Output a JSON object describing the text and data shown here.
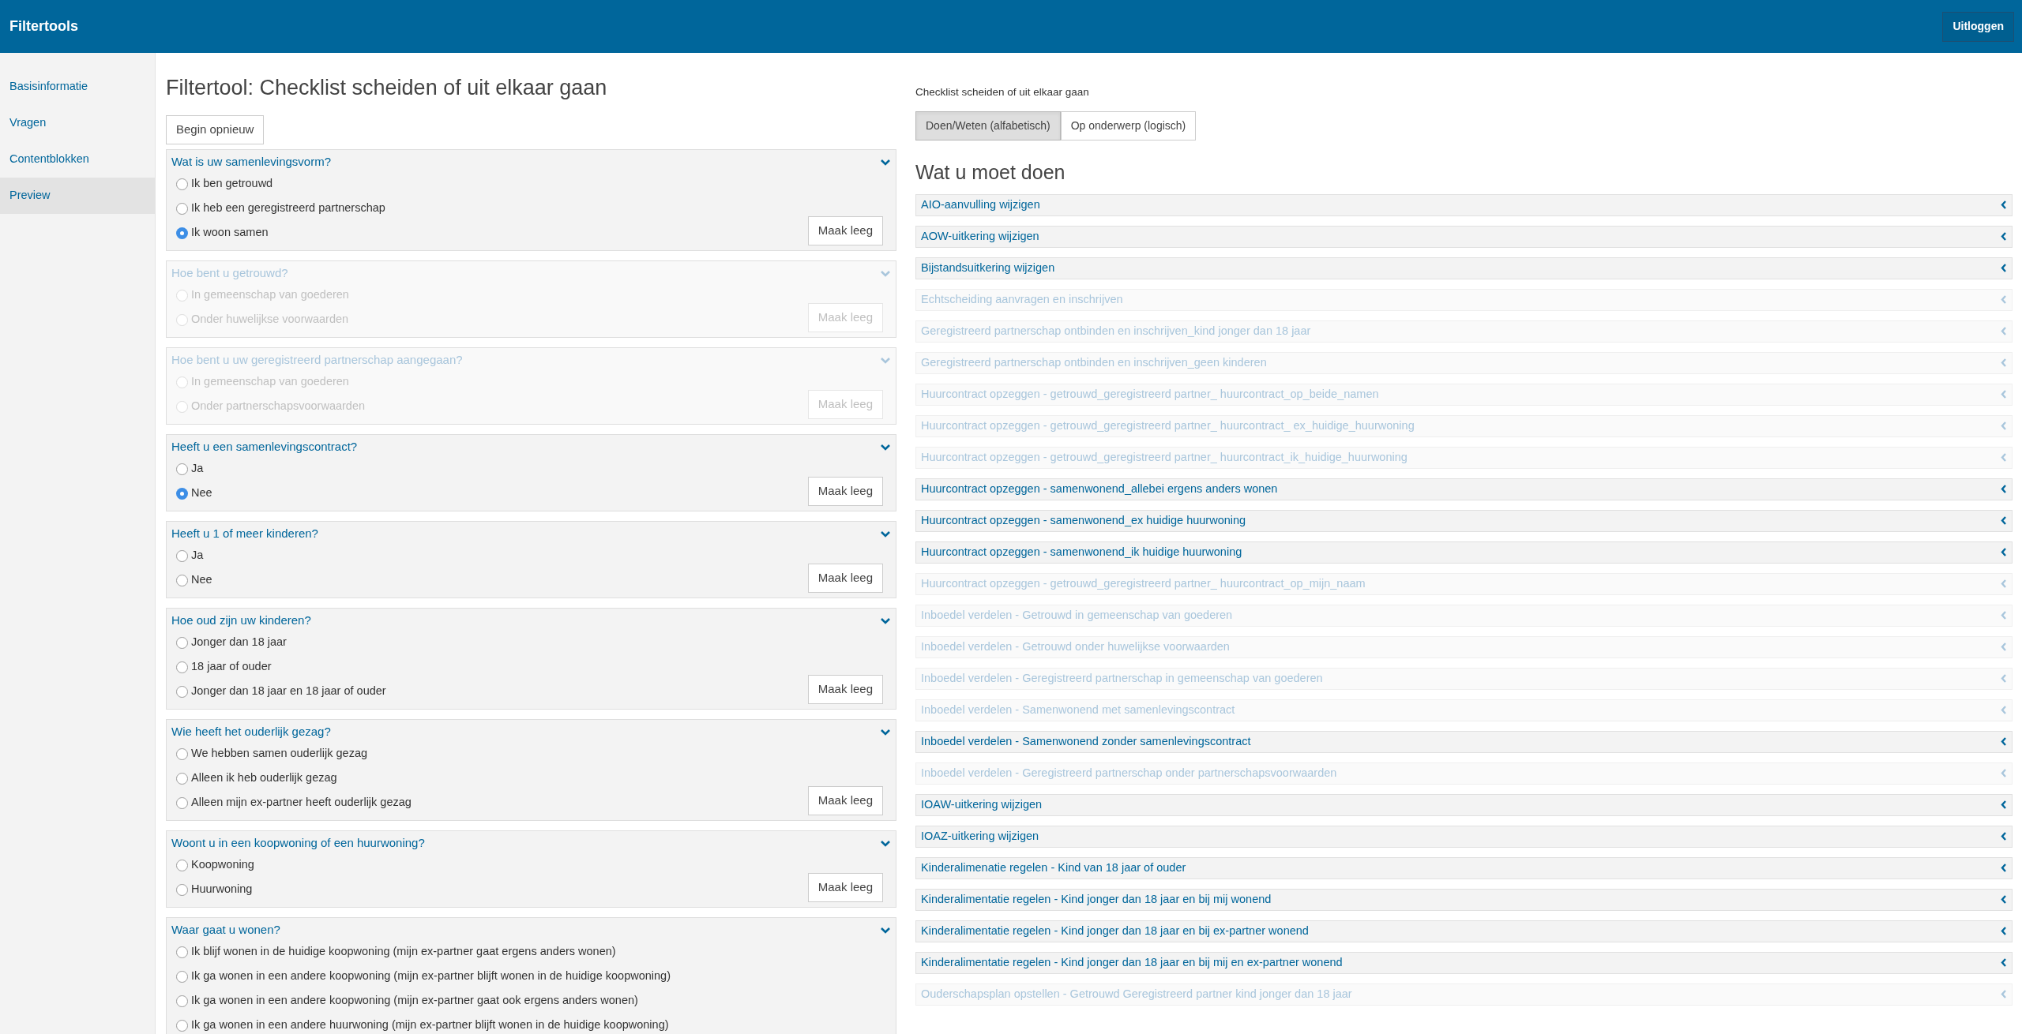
{
  "header": {
    "title": "Filtertools",
    "logout_button": "Uitloggen"
  },
  "sidebar": {
    "items": [
      {
        "label": "Basisinformatie",
        "selected": false
      },
      {
        "label": "Vragen",
        "selected": false
      },
      {
        "label": "Contentblokken",
        "selected": false
      },
      {
        "label": "Preview",
        "selected": true
      }
    ]
  },
  "page_title": "Filtertool: Checklist scheiden of uit elkaar gaan",
  "restart_button": "Begin opnieuw",
  "questions": [
    {
      "title": "Wat is uw samenlevingsvorm?",
      "disabled": false,
      "clear_button": "Maak leeg",
      "options": [
        {
          "label": "Ik ben getrouwd",
          "selected": false
        },
        {
          "label": "Ik heb een geregistreerd partnerschap",
          "selected": false
        },
        {
          "label": "Ik woon samen",
          "selected": true
        }
      ]
    },
    {
      "title": "Hoe bent u getrouwd?",
      "disabled": true,
      "clear_button": "Maak leeg",
      "options": [
        {
          "label": "In gemeenschap van goederen",
          "selected": false
        },
        {
          "label": "Onder huwelijkse voorwaarden",
          "selected": false
        }
      ]
    },
    {
      "title": "Hoe bent u uw geregistreerd partnerschap aangegaan?",
      "disabled": true,
      "clear_button": "Maak leeg",
      "options": [
        {
          "label": "In gemeenschap van goederen",
          "selected": false
        },
        {
          "label": "Onder partnerschapsvoorwaarden",
          "selected": false
        }
      ]
    },
    {
      "title": "Heeft u een samenlevingscontract?",
      "disabled": false,
      "clear_button": "Maak leeg",
      "options": [
        {
          "label": "Ja",
          "selected": false
        },
        {
          "label": "Nee",
          "selected": true
        }
      ]
    },
    {
      "title": "Heeft u 1 of meer kinderen?",
      "disabled": false,
      "clear_button": "Maak leeg",
      "options": [
        {
          "label": "Ja",
          "selected": false
        },
        {
          "label": "Nee",
          "selected": false
        }
      ]
    },
    {
      "title": "Hoe oud zijn uw kinderen?",
      "disabled": false,
      "clear_button": "Maak leeg",
      "options": [
        {
          "label": "Jonger dan 18 jaar",
          "selected": false
        },
        {
          "label": "18 jaar of ouder",
          "selected": false
        },
        {
          "label": "Jonger dan 18 jaar en 18 jaar of ouder",
          "selected": false
        }
      ]
    },
    {
      "title": "Wie heeft het ouderlijk gezag?",
      "disabled": false,
      "clear_button": "Maak leeg",
      "options": [
        {
          "label": "We hebben samen ouderlijk gezag",
          "selected": false
        },
        {
          "label": "Alleen ik heb ouderlijk gezag",
          "selected": false
        },
        {
          "label": "Alleen mijn ex-partner heeft ouderlijk gezag",
          "selected": false
        }
      ]
    },
    {
      "title": "Woont u in een koopwoning of een huurwoning?",
      "disabled": false,
      "clear_button": "Maak leeg",
      "options": [
        {
          "label": "Koopwoning",
          "selected": false
        },
        {
          "label": "Huurwoning",
          "selected": false
        }
      ]
    },
    {
      "title": "Waar gaat u wonen?",
      "disabled": false,
      "options": [
        {
          "label": "Ik blijf wonen in de huidige koopwoning (mijn ex-partner gaat ergens anders wonen)",
          "selected": false
        },
        {
          "label": "Ik ga wonen in een andere koopwoning (mijn ex-partner blijft wonen in de huidige koopwoning)",
          "selected": false
        },
        {
          "label": "Ik ga wonen in een andere koopwoning (mijn ex-partner gaat ook ergens anders wonen)",
          "selected": false
        },
        {
          "label": "Ik ga wonen in een andere huurwoning (mijn ex-partner blijft wonen in de huidige koopwoning)",
          "selected": false
        }
      ]
    }
  ],
  "checklist": {
    "title": "Checklist scheiden of uit elkaar gaan",
    "view_tabs": [
      {
        "label": "Doen/Weten (alfabetisch)",
        "selected": true
      },
      {
        "label": "Op onderwerp (logisch)",
        "selected": false
      }
    ],
    "section_title": "Wat u moet doen",
    "items": [
      {
        "label": "AIO-aanvulling wijzigen",
        "disabled": false
      },
      {
        "label": "AOW-uitkering wijzigen",
        "disabled": false
      },
      {
        "label": "Bijstandsuitkering wijzigen",
        "disabled": false
      },
      {
        "label": "Echtscheiding aanvragen en inschrijven",
        "disabled": true
      },
      {
        "label": "Geregistreerd partnerschap ontbinden en inschrijven_kind jonger dan 18 jaar",
        "disabled": true
      },
      {
        "label": "Geregistreerd partnerschap ontbinden en inschrijven_geen kinderen",
        "disabled": true
      },
      {
        "label": "Huurcontract opzeggen - getrouwd_geregistreerd partner_ huurcontract_op_beide_namen",
        "disabled": true
      },
      {
        "label": "Huurcontract opzeggen - getrouwd_geregistreerd partner_ huurcontract_ ex_huidige_huurwoning",
        "disabled": true
      },
      {
        "label": "Huurcontract opzeggen - getrouwd_geregistreerd partner_ huurcontract_ik_huidige_huurwoning",
        "disabled": true
      },
      {
        "label": "Huurcontract opzeggen - samenwonend_allebei ergens anders wonen",
        "disabled": false
      },
      {
        "label": "Huurcontract opzeggen - samenwonend_ex huidige huurwoning",
        "disabled": false
      },
      {
        "label": "Huurcontract opzeggen - samenwonend_ik huidige huurwoning",
        "disabled": false
      },
      {
        "label": "Huurcontract opzeggen - getrouwd_geregistreerd partner_ huurcontract_op_mijn_naam",
        "disabled": true
      },
      {
        "label": "Inboedel verdelen - Getrouwd in gemeenschap van goederen",
        "disabled": true
      },
      {
        "label": "Inboedel verdelen - Getrouwd onder huwelijkse voorwaarden",
        "disabled": true
      },
      {
        "label": "Inboedel verdelen - Geregistreerd partnerschap in gemeenschap van goederen",
        "disabled": true
      },
      {
        "label": "Inboedel verdelen - Samenwonend met samenlevingscontract",
        "disabled": true
      },
      {
        "label": "Inboedel verdelen - Samenwonend zonder samenlevingscontract",
        "disabled": false
      },
      {
        "label": "Inboedel verdelen - Geregistreerd partnerschap onder partnerschapsvoorwaarden",
        "disabled": true
      },
      {
        "label": "IOAW-uitkering wijzigen",
        "disabled": false
      },
      {
        "label": "IOAZ-uitkering wijzigen",
        "disabled": false
      },
      {
        "label": "Kinderalimenatie regelen - Kind van 18 jaar of ouder",
        "disabled": false
      },
      {
        "label": "Kinderalimentatie regelen - Kind jonger dan 18 jaar en bij mij wonend",
        "disabled": false
      },
      {
        "label": "Kinderalimentatie regelen - Kind jonger dan 18 jaar en bij ex-partner wonend",
        "disabled": false
      },
      {
        "label": "Kinderalimentatie regelen - Kind jonger dan 18 jaar en bij mij en ex-partner wonend",
        "disabled": false
      },
      {
        "label": "Ouderschapsplan opstellen - Getrouwd Geregistreerd partner kind jonger dan 18 jaar",
        "disabled": true
      }
    ]
  }
}
